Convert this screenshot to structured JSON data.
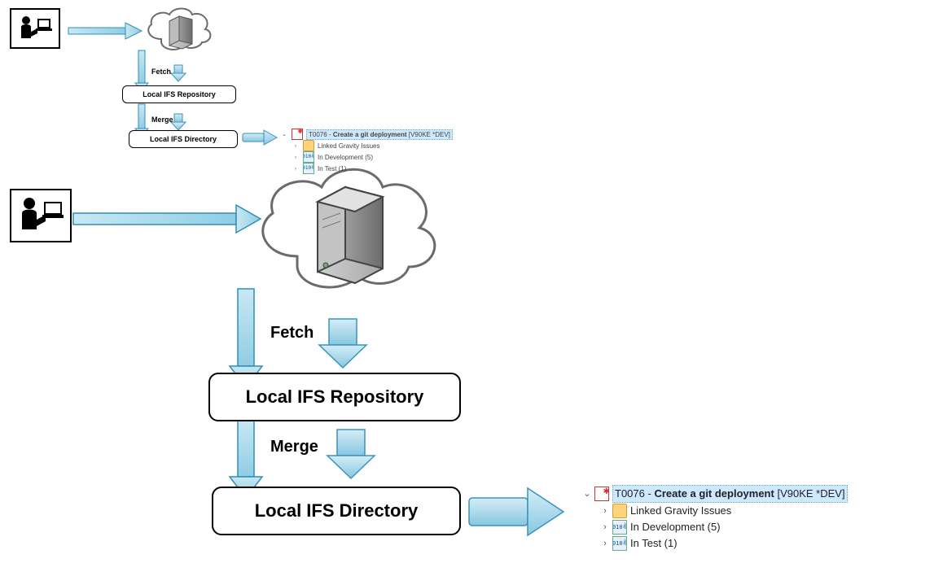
{
  "labels": {
    "fetch": "Fetch",
    "merge": "Merge",
    "local_repo": "Local IFS Repository",
    "local_dir": "Local IFS Directory"
  },
  "tree": {
    "root_id": "T0076",
    "root_title": "Create a git deployment",
    "root_env": "[V90KE *DEV]",
    "children": [
      {
        "label": "Linked Gravity Issues",
        "icon": "people"
      },
      {
        "label": "In Development (5)",
        "icon": "binary"
      },
      {
        "label": "In Test (1)",
        "icon": "binary"
      }
    ]
  },
  "colors": {
    "arrow_fill": "#9fd4e8",
    "arrow_stroke": "#2f8fb5",
    "block_arrow_fill": "#a7d8ec",
    "block_arrow_stroke": "#3a93ba"
  }
}
